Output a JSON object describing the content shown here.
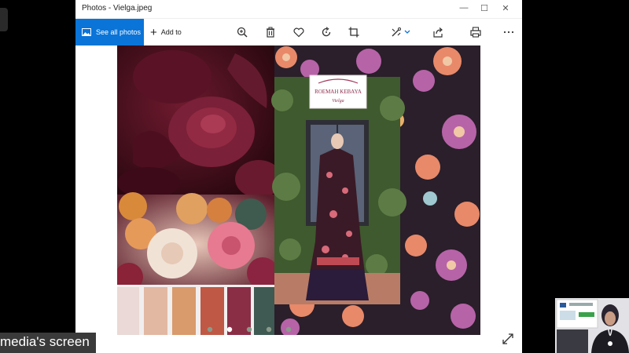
{
  "window": {
    "title": "Photos - Vielga.jpeg",
    "controls": [
      "—",
      "☐",
      "✕"
    ]
  },
  "toolbar": {
    "see_all_label": "See all photos",
    "add_to_label": "Add to",
    "icons": [
      "zoom-in-icon",
      "delete-icon",
      "favorite-icon",
      "rotate-icon",
      "crop-icon",
      "edit-icon",
      "share-icon",
      "print-icon",
      "more-icon"
    ]
  },
  "photo": {
    "logo_text": "ROEMAH KEBAYA",
    "logo_script": "Vielga",
    "palette": [
      "#ead9d6",
      "#e2b8a2",
      "#d99a6c",
      "#bf5844",
      "#8a2e46",
      "#3e5a52"
    ],
    "slide_count": 5,
    "active_slide": 2
  },
  "screen_share": {
    "label": "media's screen"
  }
}
